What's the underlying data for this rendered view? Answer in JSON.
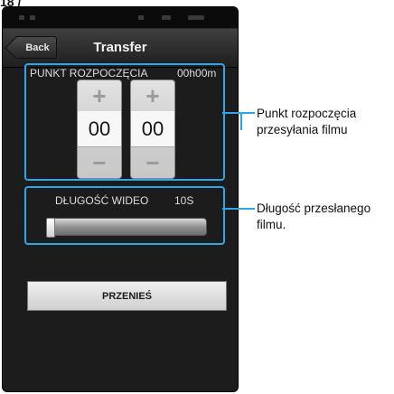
{
  "page_fragment": "18 /",
  "status_bar": {},
  "header": {
    "back_label": "Back",
    "title": "Transfer"
  },
  "start_point": {
    "label": "PUNKT ROZPOCZĘCIA",
    "value": "00h00m",
    "spinners": [
      {
        "plus": "+",
        "value": "00",
        "minus": "−"
      },
      {
        "plus": "+",
        "value": "00",
        "minus": "−"
      }
    ]
  },
  "video_length": {
    "label": "DŁUGOŚĆ WIDEO",
    "value": "10S",
    "slider_fraction": 0.0
  },
  "transfer_button": {
    "label": "PRZENIEŚ"
  },
  "callouts": [
    {
      "line1": "Punkt rozpoczęcia",
      "line2": "przesyłania filmu"
    },
    {
      "line1": "Długość przesłanego",
      "line2": "filmu."
    }
  ],
  "colors": {
    "highlight": "#28a8e6",
    "screen_bg": "#1c1c1c"
  }
}
